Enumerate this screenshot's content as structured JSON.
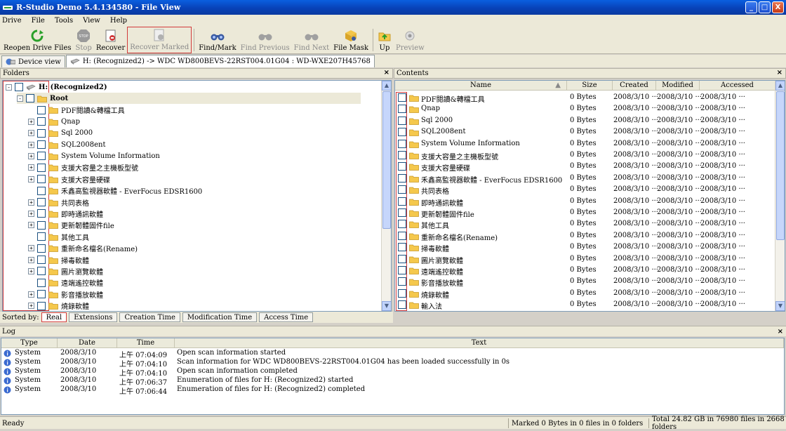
{
  "window": {
    "title": "R-Studio Demo 5.4.134580 - File View",
    "controls": {
      "minimize": "_",
      "maximize": "□",
      "close": "X"
    }
  },
  "menu": [
    "Drive",
    "File",
    "Tools",
    "View",
    "Help"
  ],
  "toolbar": [
    {
      "label": "Reopen Drive Files",
      "icon": "reopen-icon",
      "enabled": true
    },
    {
      "label": "Stop",
      "icon": "stop-icon",
      "enabled": false
    },
    {
      "label": "Recover",
      "icon": "recover-icon",
      "enabled": true
    },
    {
      "label": "Recover Marked",
      "icon": "recover-marked-icon",
      "enabled": false,
      "highlighted": true
    },
    {
      "label": "Find/Mark",
      "icon": "binoculars-icon",
      "enabled": true
    },
    {
      "label": "Find Previous",
      "icon": "find-previous-icon",
      "enabled": false
    },
    {
      "label": "Find Next",
      "icon": "find-next-icon",
      "enabled": false
    },
    {
      "label": "File Mask",
      "icon": "file-mask-icon",
      "enabled": true
    },
    {
      "label": "Up",
      "icon": "folder-up-icon",
      "enabled": true
    },
    {
      "label": "Preview",
      "icon": "preview-icon",
      "enabled": false
    }
  ],
  "tabs": [
    {
      "label": "Device view",
      "active": false
    },
    {
      "label": "H: (Recognized2) -> WDC WD800BEVS-22RST004.01G04 : WD-WXE207H45768",
      "active": true
    }
  ],
  "folders_panel": {
    "title": "Folders",
    "close": "×",
    "tree": [
      {
        "level": 0,
        "expander": "-",
        "label": "H: (Recognized2)",
        "bold": true,
        "icon": "drive-icon"
      },
      {
        "level": 1,
        "expander": "-",
        "label": "Root",
        "bold": true,
        "icon": "folder-open-icon"
      },
      {
        "level": 2,
        "expander": "",
        "label": "PDF閱讀&轉檔工具"
      },
      {
        "level": 2,
        "expander": "+",
        "label": "Qnap"
      },
      {
        "level": 2,
        "expander": "+",
        "label": "Sql 2000"
      },
      {
        "level": 2,
        "expander": "+",
        "label": "SQL2008ent"
      },
      {
        "level": 2,
        "expander": "+",
        "label": "System Volume Information"
      },
      {
        "level": 2,
        "expander": "+",
        "label": "支援大容量之主機板型號"
      },
      {
        "level": 2,
        "expander": "+",
        "label": "支援大容量硬碟"
      },
      {
        "level": 2,
        "expander": "",
        "label": "禾鑫高監視器軟體 - EverFocus EDSR1600"
      },
      {
        "level": 2,
        "expander": "+",
        "label": "共同表格"
      },
      {
        "level": 2,
        "expander": "+",
        "label": "即時通訊軟體"
      },
      {
        "level": 2,
        "expander": "+",
        "label": "更新韌體固件file"
      },
      {
        "level": 2,
        "expander": "",
        "label": "其他工具"
      },
      {
        "level": 2,
        "expander": "+",
        "label": "重新命名檔名(Rename)"
      },
      {
        "level": 2,
        "expander": "+",
        "label": "掃毒軟體"
      },
      {
        "level": 2,
        "expander": "+",
        "label": "圖片瀏覽軟體"
      },
      {
        "level": 2,
        "expander": "",
        "label": "遠端遙控軟體"
      },
      {
        "level": 2,
        "expander": "+",
        "label": "影音播放軟體"
      },
      {
        "level": 2,
        "expander": "+",
        "label": "燒錄軟體"
      }
    ]
  },
  "sorted_by": {
    "label": "Sorted by:",
    "options": [
      "Real",
      "Extensions",
      "Creation Time",
      "Modification Time",
      "Access Time"
    ],
    "active": "Real"
  },
  "contents_panel": {
    "title": "Contents",
    "close": "×",
    "columns": [
      "Name",
      "Size",
      "Created",
      "Modified",
      "Accessed"
    ],
    "rows": [
      {
        "name": "PDF閱讀&轉檔工具",
        "size": "0 Bytes",
        "created": "2008/3/10 ···",
        "modified": "2008/3/10 ···",
        "accessed": "2008/3/10 ···"
      },
      {
        "name": "Qnap",
        "size": "0 Bytes",
        "created": "2008/3/10 ···",
        "modified": "2008/3/10 ···",
        "accessed": "2008/3/10 ···"
      },
      {
        "name": "Sql 2000",
        "size": "0 Bytes",
        "created": "2008/3/10 ···",
        "modified": "2008/3/10 ···",
        "accessed": "2008/3/10 ···"
      },
      {
        "name": "SQL2008ent",
        "size": "0 Bytes",
        "created": "2008/3/10 ···",
        "modified": "2008/3/10 ···",
        "accessed": "2008/3/10 ···"
      },
      {
        "name": "System Volume Information",
        "size": "0 Bytes",
        "created": "2008/3/10 ···",
        "modified": "2008/3/10 ···",
        "accessed": "2008/3/10 ···"
      },
      {
        "name": "支援大容量之主機板型號",
        "size": "0 Bytes",
        "created": "2008/3/10 ···",
        "modified": "2008/3/10 ···",
        "accessed": "2008/3/10 ···"
      },
      {
        "name": "支援大容量硬碟",
        "size": "0 Bytes",
        "created": "2008/3/10 ···",
        "modified": "2008/3/10 ···",
        "accessed": "2008/3/10 ···"
      },
      {
        "name": "禾鑫高監視器軟體 - EverFocus EDSR1600",
        "size": "0 Bytes",
        "created": "2008/3/10 ···",
        "modified": "2008/3/10 ···",
        "accessed": "2008/3/10 ···"
      },
      {
        "name": "共同表格",
        "size": "0 Bytes",
        "created": "2008/3/10 ···",
        "modified": "2008/3/10 ···",
        "accessed": "2008/3/10 ···"
      },
      {
        "name": "即時通訊軟體",
        "size": "0 Bytes",
        "created": "2008/3/10 ···",
        "modified": "2008/3/10 ···",
        "accessed": "2008/3/10 ···"
      },
      {
        "name": "更新韌體固件file",
        "size": "0 Bytes",
        "created": "2008/3/10 ···",
        "modified": "2008/3/10 ···",
        "accessed": "2008/3/10 ···"
      },
      {
        "name": "其他工具",
        "size": "0 Bytes",
        "created": "2008/3/10 ···",
        "modified": "2008/3/10 ···",
        "accessed": "2008/3/10 ···"
      },
      {
        "name": "重新命名檔名(Rename)",
        "size": "0 Bytes",
        "created": "2008/3/10 ···",
        "modified": "2008/3/10 ···",
        "accessed": "2008/3/10 ···"
      },
      {
        "name": "掃毒軟體",
        "size": "0 Bytes",
        "created": "2008/3/10 ···",
        "modified": "2008/3/10 ···",
        "accessed": "2008/3/10 ···"
      },
      {
        "name": "圖片瀏覽軟體",
        "size": "0 Bytes",
        "created": "2008/3/10 ···",
        "modified": "2008/3/10 ···",
        "accessed": "2008/3/10 ···"
      },
      {
        "name": "遠端遙控軟體",
        "size": "0 Bytes",
        "created": "2008/3/10 ···",
        "modified": "2008/3/10 ···",
        "accessed": "2008/3/10 ···"
      },
      {
        "name": "影音播放軟體",
        "size": "0 Bytes",
        "created": "2008/3/10 ···",
        "modified": "2008/3/10 ···",
        "accessed": "2008/3/10 ···"
      },
      {
        "name": "燒錄軟體",
        "size": "0 Bytes",
        "created": "2008/3/10 ···",
        "modified": "2008/3/10 ···",
        "accessed": "2008/3/10 ···"
      },
      {
        "name": "輸入法",
        "size": "0 Bytes",
        "created": "2008/3/10 ···",
        "modified": "2008/3/10 ···",
        "accessed": "2008/3/10 ···"
      }
    ]
  },
  "log_panel": {
    "title": "Log",
    "close": "×",
    "columns": [
      "Type",
      "Date",
      "Time",
      "Text"
    ],
    "rows": [
      {
        "type": "System",
        "date": "2008/3/10",
        "time": "上午 07:04:09",
        "text": "Open scan information started"
      },
      {
        "type": "System",
        "date": "2008/3/10",
        "time": "上午 07:04:10",
        "text": "Scan information for WDC WD800BEVS-22RST004.01G04 has been loaded successfully in 0s"
      },
      {
        "type": "System",
        "date": "2008/3/10",
        "time": "上午 07:04:10",
        "text": "Open scan information completed"
      },
      {
        "type": "System",
        "date": "2008/3/10",
        "time": "上午 07:06:37",
        "text": "Enumeration of files for H: (Recognized2) started"
      },
      {
        "type": "System",
        "date": "2008/3/10",
        "time": "上午 07:06:44",
        "text": "Enumeration of files for H: (Recognized2) completed"
      }
    ]
  },
  "status": {
    "left": "Ready",
    "middle": "Marked 0 Bytes in 0 files in 0 folders",
    "right": "Total 24.82 GB in 76980 files in 2668 folders"
  },
  "colors": {
    "title_bar": "#0842b8",
    "highlight_red": "#d23a3a",
    "folder_yellow": "#f5c84c",
    "panel_bg": "#ece9d8"
  }
}
